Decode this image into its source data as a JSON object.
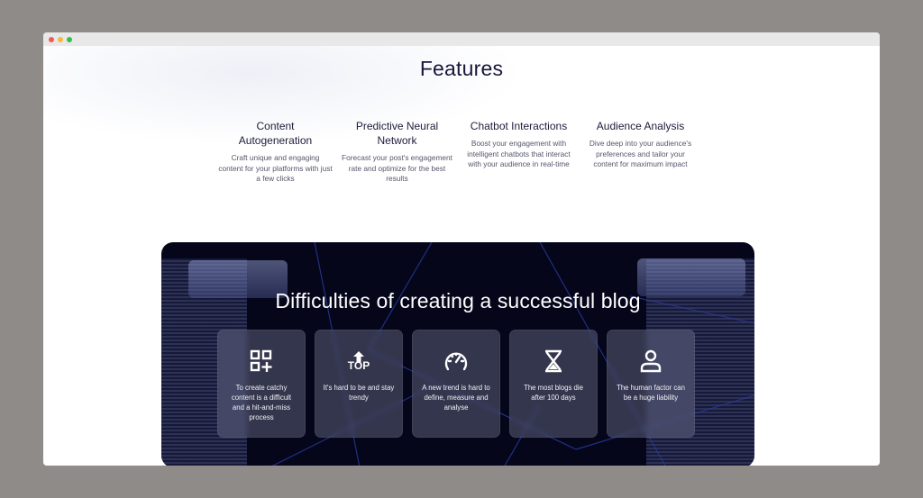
{
  "window": {
    "controls": [
      "close",
      "minimize",
      "maximize"
    ]
  },
  "features_section": {
    "title": "Features",
    "items": [
      {
        "title": "Content Autogeneration",
        "description": "Craft unique and engaging content for your platforms with just a few clicks"
      },
      {
        "title": "Predictive Neural Network",
        "description": "Forecast your post's engagement rate and optimize for the best results"
      },
      {
        "title": "Chatbot Interactions",
        "description": "Boost your engagement with intelligent chatbots that interact with your audience in real-time"
      },
      {
        "title": "Audience Analysis",
        "description": "Dive deep into your audience's preferences and tailor your content for maximum impact"
      }
    ]
  },
  "difficulties_section": {
    "title": "Difficulties of creating a successful blog",
    "cards": [
      {
        "icon": "add-widget-icon",
        "text": "To create catchy content is a difficult and a hit-and-miss process"
      },
      {
        "icon": "top-arrow-icon",
        "icon_label": "TOP",
        "text": "It's hard to be and stay trendy"
      },
      {
        "icon": "speedometer-icon",
        "text": "A new trend is hard to define, measure and analyse"
      },
      {
        "icon": "hourglass-icon",
        "text": "The most blogs die after 100 days"
      },
      {
        "icon": "user-icon",
        "text": "The human factor can be a huge liability"
      }
    ]
  },
  "colors": {
    "backdrop": "#8e8b89",
    "heading": "#18163a",
    "body_text": "#55566a",
    "hero_bg": "#05061a",
    "card_text": "#f2f2f6"
  }
}
